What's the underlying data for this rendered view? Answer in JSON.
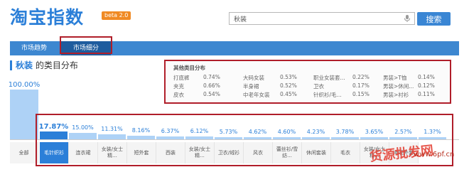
{
  "header": {
    "logo": "淘宝指数",
    "beta": "beta 2.0",
    "search_value": "秋装",
    "search_button": "搜索"
  },
  "nav": {
    "tabs": [
      {
        "label": "市场趋势",
        "active": false
      },
      {
        "label": "市场细分",
        "active": true
      }
    ]
  },
  "section": {
    "keyword": "秋装",
    "title_suffix": " 的类目分布"
  },
  "other_categories": {
    "title": "其他类目分布",
    "items": [
      {
        "name": "打底裤",
        "pct": "0.74%"
      },
      {
        "name": "夹克",
        "pct": "0.66%"
      },
      {
        "name": "皮衣",
        "pct": "0.54%"
      },
      {
        "name": "大码女装",
        "pct": "0.53%"
      },
      {
        "name": "半身裙",
        "pct": "0.52%"
      },
      {
        "name": "中老年女装",
        "pct": "0.45%"
      },
      {
        "name": "职业女装套...",
        "pct": "0.22%"
      },
      {
        "name": "卫衣",
        "pct": "0.17%"
      },
      {
        "name": "针织衫/毛...",
        "pct": "0.15%"
      },
      {
        "name": "男装>T恤",
        "pct": "0.14%"
      },
      {
        "name": "男装>休闲...",
        "pct": "0.12%"
      },
      {
        "name": "男装>衬衫",
        "pct": "0.11%"
      }
    ]
  },
  "chart_data": {
    "type": "bar",
    "categories": [
      "全部",
      "毛针织衫",
      "连衣裙",
      "女装/女士精...",
      "短外套",
      "西装",
      "女装/女士精...",
      "卫衣/绒衫",
      "风衣",
      "蕾丝衫/雪纺...",
      "休闲套装",
      "毛衣",
      "女装/女士精...",
      "毛呢外套"
    ],
    "values": [
      100.0,
      17.87,
      15.0,
      11.31,
      8.16,
      6.37,
      6.12,
      5.73,
      4.62,
      4.6,
      4.23,
      3.78,
      3.65,
      2.5,
      1.3
    ],
    "value_labels": [
      "100.00%",
      "17.87%",
      "15.00%",
      "11.31%",
      "8.16%",
      "6.37%",
      "6.12%",
      "5.73%",
      "4.62%",
      "4.60%",
      "4.23%",
      "3.78%",
      "3.65%",
      "2.5?%",
      "1.3?%"
    ],
    "selected_index": 1,
    "bar_color": "#aed2f6",
    "selected_color": "#2b7fd8"
  },
  "watermark": {
    "text": "货源批发网",
    "url": "www.6pf.cn"
  },
  "colors": {
    "accent": "#2b7fd8",
    "highlight": "#b01e2a"
  }
}
